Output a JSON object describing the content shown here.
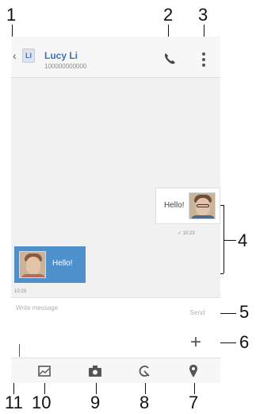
{
  "header": {
    "back_label": "‹",
    "avatar_letter": "Ll",
    "contact_name": "Lucy Li",
    "contact_number": "100000000000",
    "call_icon": "phone-icon",
    "menu_icon": "overflow-menu-icon"
  },
  "conversation": {
    "incoming": {
      "text": "Hello!",
      "timestamp": "✓ 10:23"
    },
    "outgoing": {
      "text": "Hello!",
      "timestamp": "10:23"
    }
  },
  "composer": {
    "placeholder": "Write message",
    "send_label": "Send",
    "add_label": "+"
  },
  "attachments": [
    {
      "name": "gallery-icon"
    },
    {
      "name": "camera-icon"
    },
    {
      "name": "sketch-icon"
    },
    {
      "name": "location-icon"
    }
  ],
  "callouts": [
    "1",
    "2",
    "3",
    "4",
    "5",
    "6",
    "7",
    "8",
    "9",
    "10",
    "11"
  ],
  "colors": {
    "accent": "#3e72b8",
    "outgoing_bubble": "#4e90cc",
    "background": "#f1f1f1"
  }
}
